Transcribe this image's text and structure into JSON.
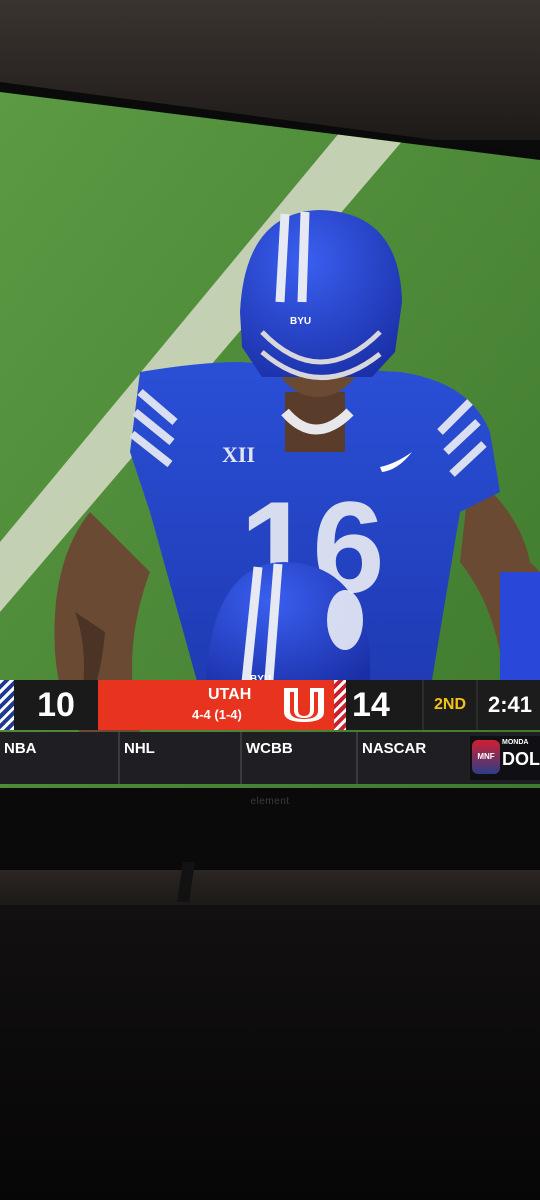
{
  "scoreboard": {
    "away_score": "10",
    "home_team": "UTAH",
    "home_record": "4-4 (1-4)",
    "home_score": "14",
    "quarter": "2ND",
    "clock": "2:41"
  },
  "ticker": {
    "items": [
      "NBA",
      "NHL",
      "WCBB",
      "NASCAR"
    ],
    "promo_badge": "MNF",
    "promo_day": "MONDA",
    "promo_team": "DOLP"
  },
  "helmet_text": "BYU",
  "jersey": {
    "number": "16",
    "conference_mark": "XII"
  },
  "bezel_brand": "element",
  "colors": {
    "byu_blue": "#1f3fc4",
    "utah_red": "#e8331f",
    "quarter_gold": "#f3c21a",
    "turf": "#4e8b3a"
  }
}
